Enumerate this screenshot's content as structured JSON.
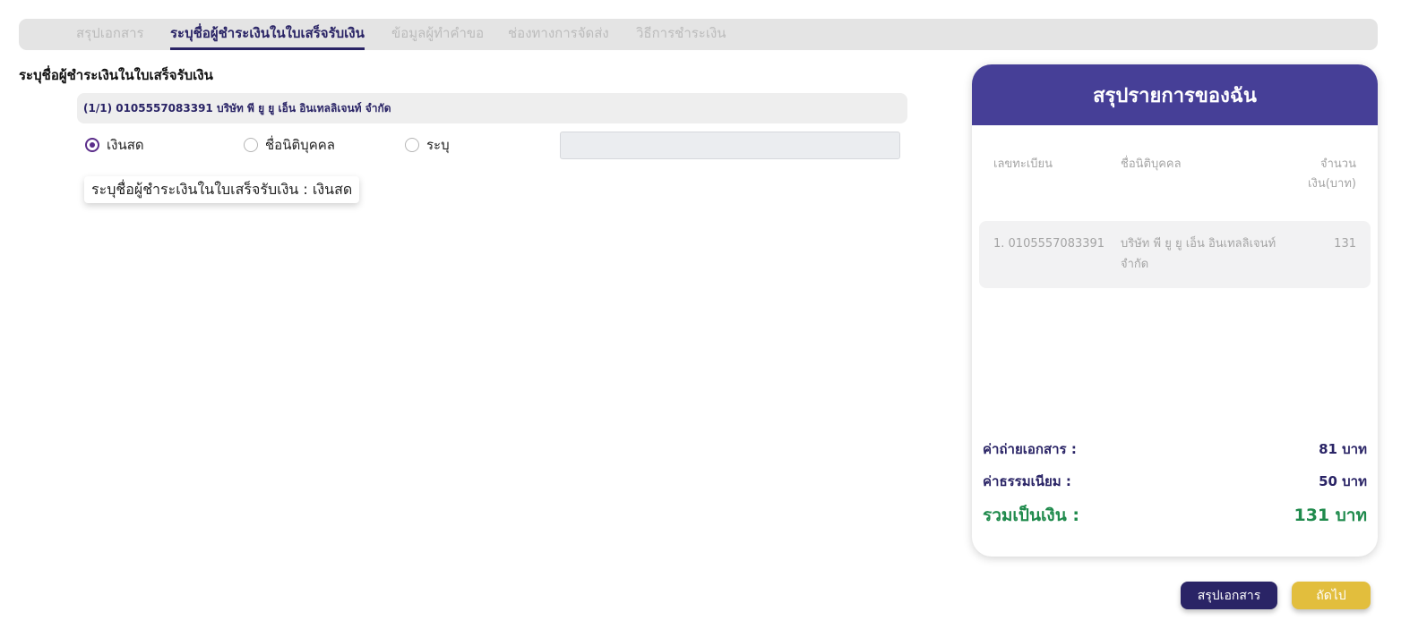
{
  "steps": [
    {
      "label": "สรุปเอกสาร",
      "active": false
    },
    {
      "label": "ระบุชื่อผู้ชำระเงินในใบเสร็จรับเงิน",
      "active": true
    },
    {
      "label": "ข้อมูลผู้ทำคำขอ",
      "active": false
    },
    {
      "label": "ช่องทางการจัดส่ง",
      "active": false
    },
    {
      "label": "วิธีการชำระเงิน",
      "active": false
    }
  ],
  "section_title": "ระบุชื่อผู้ชำระเงินในใบเสร็จรับเงิน",
  "company": {
    "label": "(1/1) 0105557083391 บริษัท พี ยู ยู เอ็น อินเทลลิเจนท์ จำกัด"
  },
  "payer_options": [
    {
      "label": "เงินสด",
      "selected": true
    },
    {
      "label": "ชื่อนิติบุคคล",
      "selected": false
    },
    {
      "label": "ระบุ",
      "selected": false
    }
  ],
  "other_input": {
    "value": "",
    "placeholder": ""
  },
  "payer_preview": "ระบุชื่อผู้ชำระเงินในใบเสร็จรับเงิน : เงินสด",
  "summary": {
    "title": "สรุปรายการของฉัน",
    "columns": [
      "เลขทะเบียน",
      "ชื่อนิติบุคคล",
      "จำนวน\nเงิน(บาท)"
    ],
    "rows": [
      {
        "reg_no": "1. 0105557083391",
        "name": "บริษัท พี ยู ยู เอ็น อินเทลลิเจนท์ จำกัด",
        "amount": "131"
      }
    ],
    "copy_fee_label": "ค่าถ่ายเอกสาร :",
    "copy_fee_value": "81 บาท",
    "service_fee_label": "ค่าธรรมเนียม :",
    "service_fee_value": "50 บาท",
    "total_label": "รวมเป็นเงิน :",
    "total_value": "131 บาท"
  },
  "buttons": {
    "summary": "สรุปเอกสาร",
    "next": "ถัดไป"
  },
  "colors": {
    "brand_purple": "#463f97",
    "dark_navy": "#2a2466",
    "radio_accent": "#5b2d8a",
    "total_green": "#1f8a4c",
    "next_yellow": "#e2be3d"
  }
}
